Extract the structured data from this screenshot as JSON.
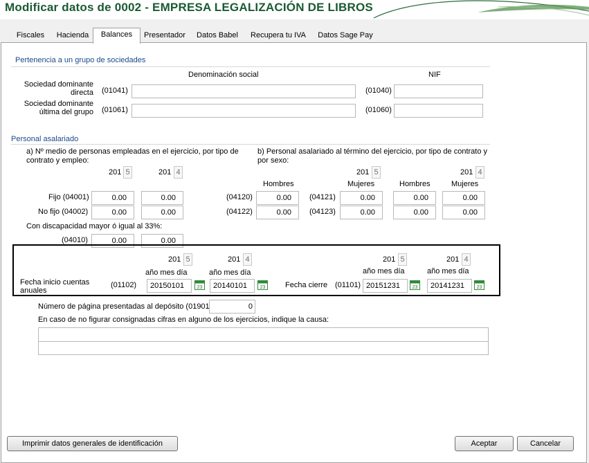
{
  "window": {
    "title": "Modificar datos de 0002 - EMPRESA LEGALIZACIÓN DE LIBROS"
  },
  "tabs": [
    {
      "label": "Fiscales"
    },
    {
      "label": "Hacienda"
    },
    {
      "label": "Balances"
    },
    {
      "label": "Presentador"
    },
    {
      "label": "Datos Babel"
    },
    {
      "label": "Recupera tu IVA"
    },
    {
      "label": "Datos Sage Pay"
    }
  ],
  "group": {
    "heading": "Pertenencia a un grupo de sociedades",
    "col_denominacion": "Denominación social",
    "col_nif": "NIF",
    "rows": [
      {
        "label_line1": "Sociedad dominante",
        "label_line2": "directa",
        "code_name": "(01041)",
        "name_value": "",
        "code_nif": "(01040)",
        "nif_value": ""
      },
      {
        "label_line1": "Sociedad dominante",
        "label_line2": "última del grupo",
        "code_name": "(01061)",
        "name_value": "",
        "code_nif": "(01060)",
        "nif_value": ""
      }
    ]
  },
  "personal": {
    "heading": "Personal asalariado",
    "a_text_line1": "a) Nº medio de personas empleadas en el ejercicio, por tipo de",
    "a_text_line2": "contrato y empleo:",
    "b_text_line1": "b) Personal asalariado al término del ejercicio, por tipo de contrato y",
    "b_text_line2": "por sexo:",
    "year_prefix": "201",
    "year_current_digit": "5",
    "year_previous_digit": "4",
    "hombres": "Hombres",
    "mujeres": "Mujeres",
    "rows": [
      {
        "label": "Fijo (04001)",
        "cur": "0.00",
        "prev": "0.00",
        "code_h": "(04120)",
        "cur_h": "0.00",
        "code_m": "(04121)",
        "cur_m": "0.00",
        "prev_h": "0.00",
        "prev_m": "0.00"
      },
      {
        "label": "No fijo (04002)",
        "cur": "0.00",
        "prev": "0.00",
        "code_h": "(04122)",
        "cur_h": "0.00",
        "code_m": "(04123)",
        "cur_m": "0.00",
        "prev_h": "0.00",
        "prev_m": "0.00"
      }
    ],
    "disc_label": "Con discapacidad mayor ó igual al 33%:",
    "disc_code": "(04010)",
    "disc_cur": "0.00",
    "disc_prev": "0.00"
  },
  "fechas": {
    "year_prefix": "201",
    "year_current_digit": "5",
    "year_previous_digit": "4",
    "format_label": "año mes día",
    "inicio_label_line1": "Fecha inicio cuentas",
    "inicio_label_line2": "anuales",
    "inicio_code": "(01102)",
    "inicio_cur": "20150101",
    "inicio_prev": "20140101",
    "cierre_label": "Fecha cierre",
    "cierre_code": "(01101)",
    "cierre_cur": "20151231",
    "cierre_prev": "20141231",
    "calendar_day": "23"
  },
  "deposito": {
    "paginas_label": "Número de página presentadas al depósito (01901)",
    "paginas_value": "0",
    "causa_label": "En caso de no figurar consignadas cifras en alguno de los ejercicios, indique la causa:",
    "causa_line1": "",
    "causa_line2": ""
  },
  "buttons": {
    "print": "Imprimir datos generales de identificación",
    "accept": "Aceptar",
    "cancel": "Cancelar"
  },
  "colors": {
    "title": "#1a5a32",
    "section": "#1a4a8a",
    "calendar": "#2f8a3a"
  }
}
